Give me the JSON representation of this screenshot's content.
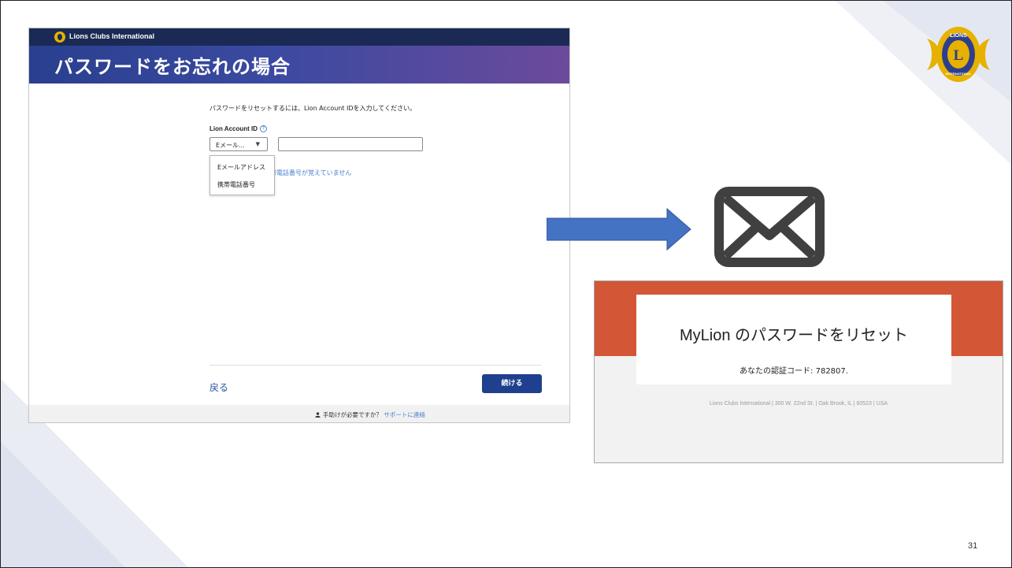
{
  "form": {
    "brand": "Lions Clubs International",
    "title": "パスワードをお忘れの場合",
    "instruction": "パスワードをリセットするには、Lion Account IDを入力してください。",
    "id_label": "Lion Account ID",
    "help_icon": "?",
    "select_value": "Eメール...",
    "select_caret": "▼",
    "id_value": "",
    "options": [
      "Eメールアドレス",
      "携帯電話番号"
    ],
    "forgot_link": "帯電話番号が覚えていません",
    "back_label": "戻る",
    "continue_label": "続ける",
    "help_question": "手助けが必要ですか？",
    "support_link": "サポートに連絡"
  },
  "email": {
    "title": "MyLion のパスワードをリセット",
    "code_text": "あなたの認証コード: 782807.",
    "footer": "Lions Clubs International | 300 W. 22nd St. | Oak Brook, IL | 60523 | USA"
  },
  "badge": {
    "top_text": "LIONS",
    "bottom_text": "INTERNATIONAL",
    "letter": "L"
  },
  "slide": {
    "page_number": "31"
  },
  "icons": [
    "lions-logo-icon",
    "help-circle-icon",
    "chevron-down-icon",
    "user-icon",
    "arrow-right-icon",
    "envelope-icon",
    "lions-badge-icon"
  ],
  "colors": {
    "topbar": "#1b2a54",
    "banner_start": "#2a3f8f",
    "banner_end": "#6c4a9c",
    "primary_button": "#1f3f8f",
    "link": "#4a80d0",
    "email_band": "#d35637",
    "arrow": "#4472c4",
    "envelope": "#404040",
    "badge_gold": "#e6b100"
  }
}
